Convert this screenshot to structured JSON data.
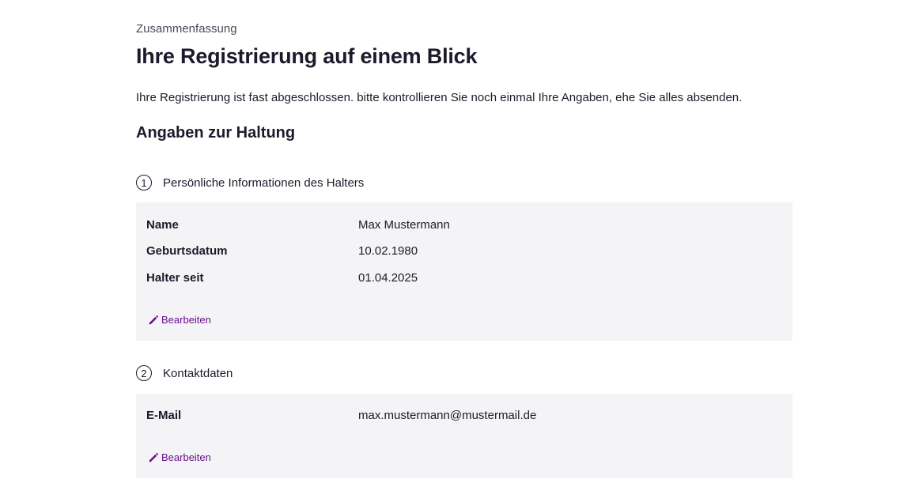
{
  "eyebrow": "Zusammenfassung",
  "title": "Ihre Registrierung auf einem Blick",
  "intro": "Ihre Registrierung ist fast abgeschlossen. bitte kontrollieren Sie noch einmal Ihre Angaben, ehe Sie alles absenden.",
  "section_heading": "Angaben zur Haltung",
  "steps": [
    {
      "number": "1",
      "title": "Persönliche Informationen des Halters",
      "rows": [
        {
          "label": "Name",
          "value": "Max Mustermann"
        },
        {
          "label": "Geburtsdatum",
          "value": "10.02.1980"
        },
        {
          "label": "Halter seit",
          "value": "01.04.2025"
        }
      ],
      "edit_label": "Bearbeiten"
    },
    {
      "number": "2",
      "title": "Kontaktdaten",
      "rows": [
        {
          "label": "E-Mail",
          "value": "max.mustermann@mustermail.de"
        }
      ],
      "edit_label": "Bearbeiten"
    }
  ],
  "colors": {
    "text": "#1b1b2b",
    "muted": "#4a4a5a",
    "card_bg": "#f4f4f6",
    "link": "#6b0f8c"
  },
  "icons": {
    "edit": "pencil-icon"
  }
}
